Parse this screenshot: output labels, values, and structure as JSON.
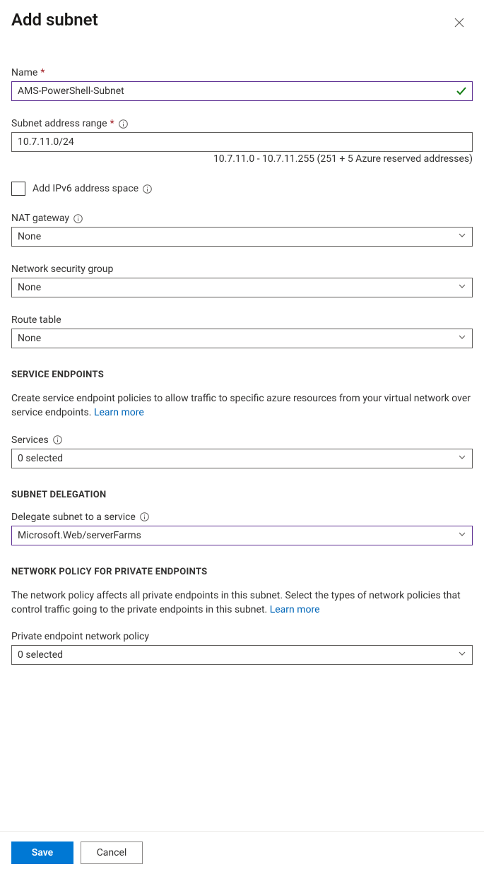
{
  "title": "Add subnet",
  "name": {
    "label": "Name",
    "value": "AMS-PowerShell-Subnet"
  },
  "subnet_range": {
    "label": "Subnet address range",
    "value": "10.7.11.0/24",
    "hint": "10.7.11.0 - 10.7.11.255 (251 + 5 Azure reserved addresses)"
  },
  "ipv6_checkbox": {
    "label": "Add IPv6 address space"
  },
  "nat_gateway": {
    "label": "NAT gateway",
    "value": "None"
  },
  "nsg": {
    "label": "Network security group",
    "value": "None"
  },
  "route_table": {
    "label": "Route table",
    "value": "None"
  },
  "service_endpoints": {
    "heading": "SERVICE ENDPOINTS",
    "description": "Create service endpoint policies to allow traffic to specific azure resources from your virtual network over service endpoints. ",
    "learn_more": "Learn more",
    "services_label": "Services",
    "services_value": "0 selected"
  },
  "subnet_delegation": {
    "heading": "SUBNET DELEGATION",
    "label": "Delegate subnet to a service",
    "value": "Microsoft.Web/serverFarms"
  },
  "network_policy": {
    "heading": "NETWORK POLICY FOR PRIVATE ENDPOINTS",
    "description": "The network policy affects all private endpoints in this subnet. Select the types of network policies that control traffic going to the private endpoints in this subnet. ",
    "learn_more": "Learn more",
    "label": "Private endpoint network policy",
    "value": "0 selected"
  },
  "footer": {
    "save_label": "Save",
    "cancel_label": "Cancel"
  }
}
